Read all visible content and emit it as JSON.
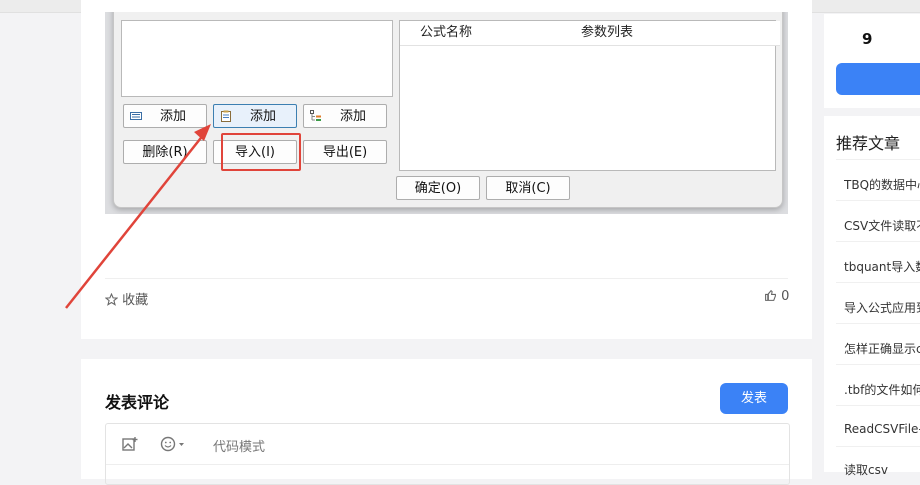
{
  "dialog": {
    "columns": [
      "公式名称",
      "参数列表"
    ],
    "add_buttons": [
      "添加",
      "添加",
      "添加"
    ],
    "delete_button": "删除(R)",
    "import_button": "导入(I)",
    "export_button": "导出(E)",
    "ok_button": "确定(O)",
    "cancel_button": "取消(C)"
  },
  "article_actions": {
    "favorite": "收藏",
    "likes": "0"
  },
  "comment": {
    "title": "发表评论",
    "publish_button": "发表",
    "code_mode": "代码模式"
  },
  "sidebar": {
    "count": "9",
    "recommended_title": "推荐文章",
    "recommended": [
      "TBQ的数据中心",
      "CSV文件读取不",
      "tbquant导入数",
      "导入公式应用到",
      "怎样正确显示c",
      ".tbf的文件如何",
      "ReadCSVFile-",
      "读取csv"
    ]
  },
  "colors": {
    "accent": "#3b82f6",
    "annotation_red": "#e0443a"
  }
}
